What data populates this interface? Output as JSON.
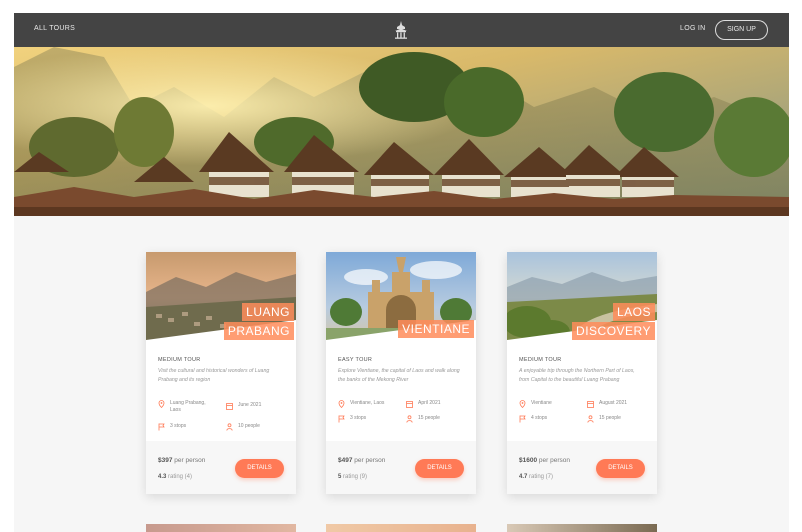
{
  "nav": {
    "all_tours": "ALL TOURS",
    "logo_icon": "temple-logo-icon",
    "login": "LOG IN",
    "signup": "SIGN UP"
  },
  "hero": {
    "image": "laos-village-stilt-houses-mountains"
  },
  "colors": {
    "accent": "#ff7a56",
    "nav_bg": "#444444",
    "page_bg": "#f6f6f6"
  },
  "cards": [
    {
      "name_lines": [
        "LUANG",
        "PRABANG"
      ],
      "meta": "MEDIUM TOUR",
      "desc": "Visit the cultural and historical wonders of Luang Prabang and its region",
      "location": "Luang Prabang, Laos",
      "date": "June 2021",
      "stops": "3 stops",
      "people": "10 people",
      "price": "$397",
      "price_suffix": " per person",
      "rating": "4.3",
      "rating_suffix": " rating (4)",
      "button": "DETAILS"
    },
    {
      "name_lines": [
        "VIENTIANE"
      ],
      "meta": "EASY TOUR",
      "desc": "Explore Vientiane, the capital of Laos and walk along the banks of the Mekong River",
      "location": "Vientiane, Laos",
      "date": "April 2021",
      "stops": "3 stops",
      "people": "15 people",
      "price": "$497",
      "price_suffix": " per person",
      "rating": "5",
      "rating_suffix": " rating (9)",
      "button": "DETAILS"
    },
    {
      "name_lines": [
        "LAOS",
        "DISCOVERY"
      ],
      "meta": "MEDIUM TOUR",
      "desc": "A enjoyable trip through the Northern Part of Laos, from Capital to the beautiful Luang Prabang",
      "location": "Vientiane",
      "date": "August 2021",
      "stops": "4 stops",
      "people": "15 people",
      "price": "$1600",
      "price_suffix": " per person",
      "rating": "4.7",
      "rating_suffix": " rating (7)",
      "button": "DETAILS"
    }
  ]
}
